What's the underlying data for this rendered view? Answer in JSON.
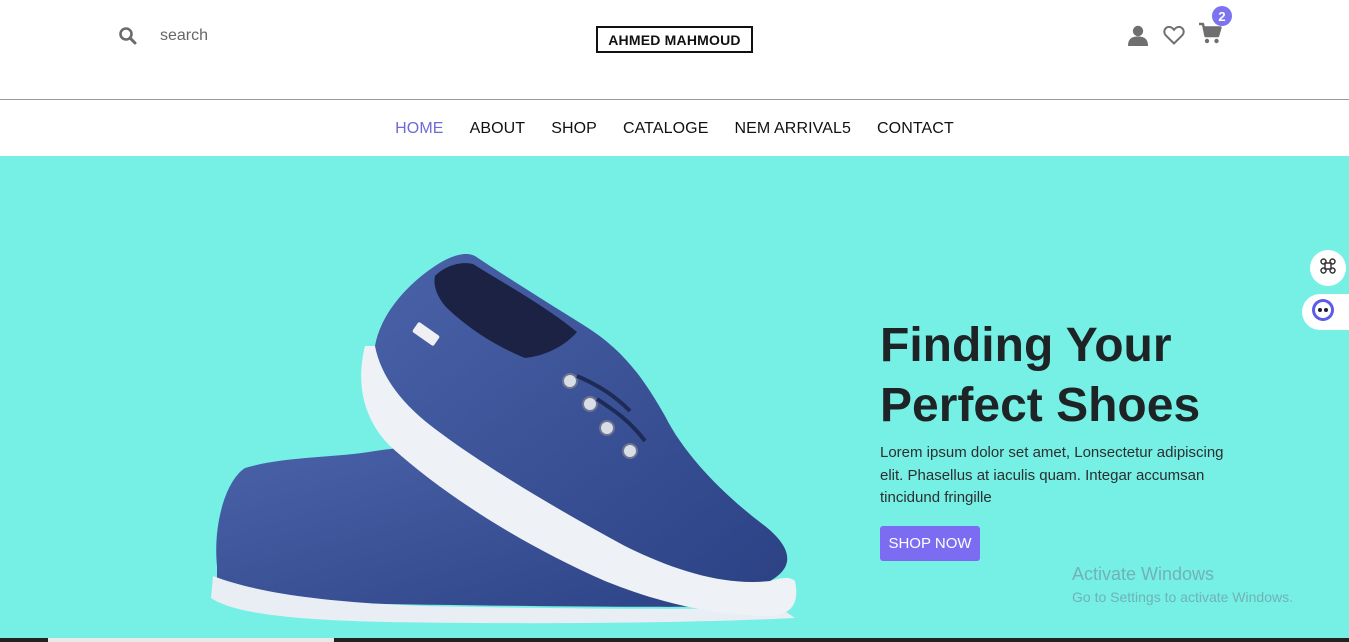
{
  "header": {
    "search": {
      "placeholder": "search",
      "icon": "search-icon"
    },
    "logo": "AHMED MAHMOUD",
    "actions": {
      "user_icon": "user-icon",
      "wishlist_icon": "heart-icon",
      "cart_icon": "cart-icon",
      "cart_count": "2"
    }
  },
  "nav": {
    "items": [
      {
        "label": "HOME",
        "active": true
      },
      {
        "label": "ABOUT"
      },
      {
        "label": "SHOP"
      },
      {
        "label": "CATALOGE"
      },
      {
        "label": "NEM ARRIVAL5"
      },
      {
        "label": "CONTACT"
      }
    ]
  },
  "hero": {
    "title_line1": "Finding Your",
    "title_line2": "Perfect Shoes",
    "description": "Lorem ipsum dolor set amet, Lonsectetur adipiscing elit. Phasellus at iaculis quam. Integar accumsan tincidund fringille",
    "button_label": "SHOP NOW",
    "background_color": "#76efe5",
    "accent_color": "#7b6cf2"
  },
  "watermark": {
    "title": "Activate Windows",
    "subtitle": "Go to Settings to activate Windows."
  },
  "floating_widgets": [
    "command-icon",
    "assistant-icon"
  ]
}
